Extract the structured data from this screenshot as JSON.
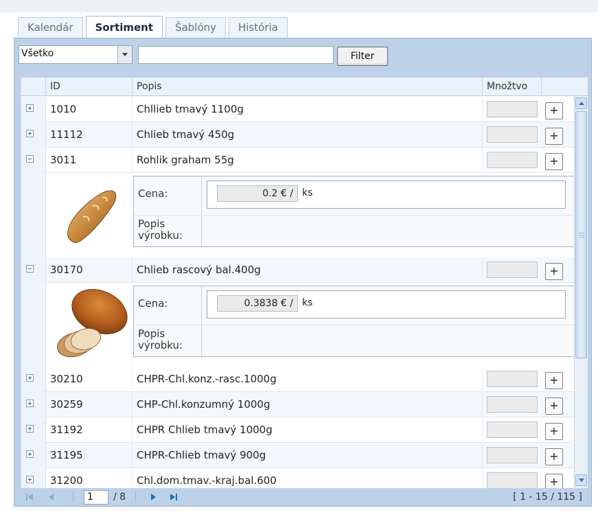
{
  "tabs": [
    {
      "label": "Kalendár",
      "active": false
    },
    {
      "label": "Sortiment",
      "active": true
    },
    {
      "label": "Šablóny",
      "active": false
    },
    {
      "label": "História",
      "active": false
    }
  ],
  "filter": {
    "select_value": "Všetko",
    "search_value": "",
    "button_label": "Filter"
  },
  "columns": {
    "id": "ID",
    "popis": "Popis",
    "mnozstvo": "Množtvo"
  },
  "rows": [
    {
      "id": "1010",
      "popis": "Chllieb tmavý 1100g",
      "expanded": false
    },
    {
      "id": "11112",
      "popis": "Chlieb tmavý 450g",
      "expanded": false
    },
    {
      "id": "3011",
      "popis": "Rohlik graham 55g",
      "expanded": true
    },
    {
      "id": "30170",
      "popis": "Chlieb rascový bal.400g",
      "expanded": true
    },
    {
      "id": "30210",
      "popis": "CHPR-Chl.konz.-rasc.1000g",
      "expanded": false
    },
    {
      "id": "30259",
      "popis": "CHP-Chl.konzumný 1000g",
      "expanded": false
    },
    {
      "id": "31192",
      "popis": "CHPR Chlieb tmavý 1000g",
      "expanded": false
    },
    {
      "id": "31195",
      "popis": "CHPR-Chlieb tmavý 900g",
      "expanded": false
    },
    {
      "id": "31200",
      "popis": "Chl.dom.tmav.-kraj.bal.600",
      "expanded": false
    }
  ],
  "details": [
    {
      "for_id": "3011",
      "cena_label": "Cena:",
      "price": "0.2 € /",
      "unit": "ks",
      "popis_label": "Popis výrobku:",
      "image": "rohlik-image"
    },
    {
      "for_id": "30170",
      "cena_label": "Cena:",
      "price": "0.3838 € /",
      "unit": "ks",
      "popis_label": "Popis výrobku:",
      "image": "bread-loaf-image"
    }
  ],
  "add_button_label": "+",
  "pager": {
    "current_page": "1",
    "total_pages": "/ 8",
    "range": "[ 1 - 15 / 115 ]"
  },
  "colors": {
    "panel": "#bdd2e8",
    "header": "#eaf2fb",
    "tab_active_text": "#1b2a3a"
  }
}
